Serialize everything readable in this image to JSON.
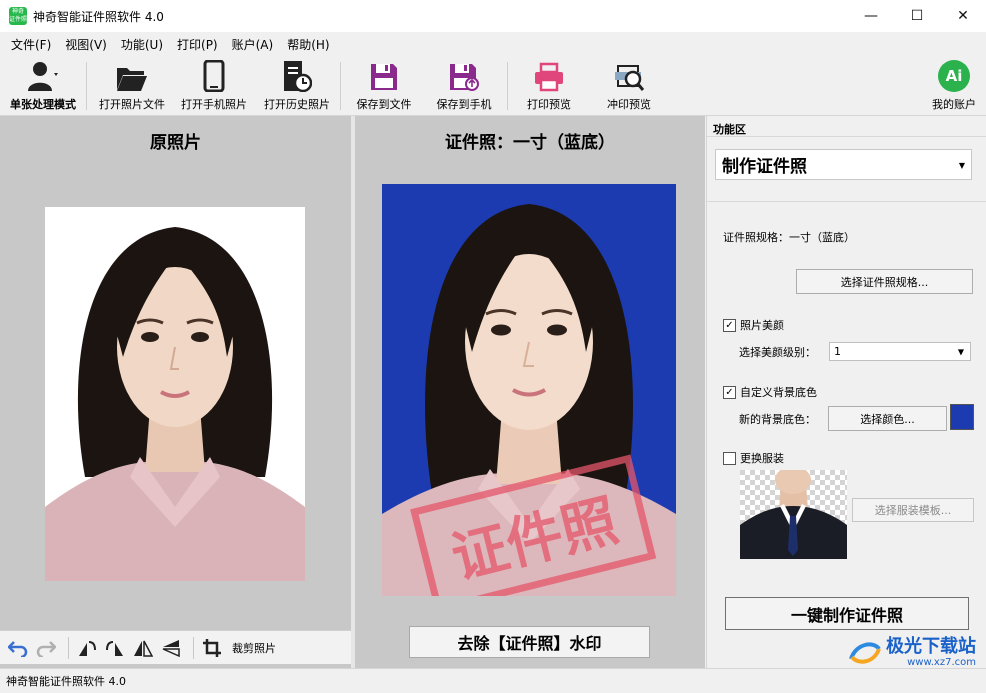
{
  "window": {
    "title": "神奇智能证件照软件 4.0",
    "app_icon_text": "神奇 证件照",
    "minimize": "—",
    "maximize": "☐",
    "close": "✕"
  },
  "menu": [
    "文件(F)",
    "视图(V)",
    "功能(U)",
    "打印(P)",
    "账户(A)",
    "帮助(H)"
  ],
  "toolbar": {
    "single_mode": "单张处理模式",
    "open_photo": "打开照片文件",
    "open_phone": "打开手机照片",
    "open_history": "打开历史照片",
    "save_file": "保存到文件",
    "save_phone": "保存到手机",
    "print_preview": "打印预览",
    "photo_print_preview": "冲印预览",
    "my_account": "我的账户",
    "account_icon_text": "Ai"
  },
  "left_panel": {
    "title": "原照片",
    "crop_label": "裁剪照片"
  },
  "mid_panel": {
    "title": "证件照：一寸（蓝底）",
    "watermark_text": "证件照",
    "remove_watermark": "去除【证件照】水印"
  },
  "func": {
    "header": "功能区",
    "mode_select": "制作证件照",
    "spec_label": "证件照规格：一寸（蓝底）",
    "choose_spec": "选择证件照规格...",
    "beauty_checkbox": "照片美颜",
    "beauty_checked": true,
    "beauty_level_label": "选择美颜级别：",
    "beauty_level": "1",
    "bg_checkbox": "自定义背景底色",
    "bg_checked": true,
    "new_bg_label": "新的背景底色：",
    "choose_color": "选择颜色...",
    "bg_color": "#1d3bb0",
    "clothes_checkbox": "更换服装",
    "clothes_checked": false,
    "choose_clothes": "选择服装模板...",
    "make_button": "一键制作证件照"
  },
  "status": {
    "text": "神奇智能证件照软件 4.0"
  },
  "brand": {
    "name": "极光下载站",
    "url": "www.xz7.com"
  }
}
